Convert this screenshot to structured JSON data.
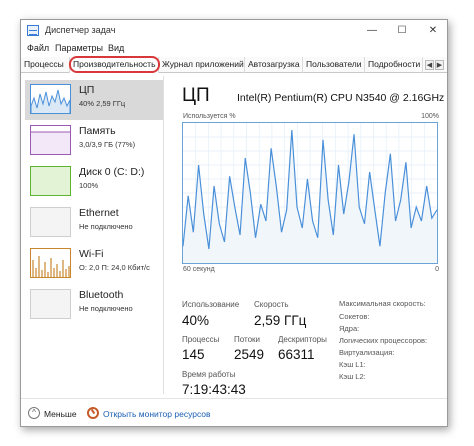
{
  "window": {
    "title": "Диспетчер задач",
    "controls": {
      "minimize": "—",
      "maximize": "☐",
      "close": "✕"
    }
  },
  "menu": [
    "Файл",
    "Параметры",
    "Вид"
  ],
  "tabs": [
    {
      "label": "Процессы",
      "active": false
    },
    {
      "label": "Производительность",
      "active": true
    },
    {
      "label": "Журнал приложений",
      "active": false
    },
    {
      "label": "Автозагрузка",
      "active": false
    },
    {
      "label": "Пользователи",
      "active": false
    },
    {
      "label": "Подробности",
      "active": false
    }
  ],
  "tab_scroll": {
    "left": "◀",
    "right": "▶"
  },
  "sidebar": [
    {
      "title": "ЦП",
      "sub": "40% 2,59 ГГц",
      "active": true,
      "color": "#4a90d9"
    },
    {
      "title": "Память",
      "sub": "3,0/3,9 ГБ (77%)",
      "active": false,
      "color": "#9b59b6"
    },
    {
      "title": "Диск 0 (C: D:)",
      "sub": "100%",
      "active": false,
      "color": "#5cb531"
    },
    {
      "title": "Ethernet",
      "sub": "Не подключено",
      "active": false,
      "color": "#aaaaaa"
    },
    {
      "title": "Wi-Fi",
      "sub": "О: 2,0 П: 24,0 Кбит/с",
      "active": false,
      "color": "#c8872f"
    },
    {
      "title": "Bluetooth",
      "sub": "Не подключено",
      "active": false,
      "color": "#aaaaaa"
    }
  ],
  "main": {
    "title": "ЦП",
    "subtitle": "Intel(R) Pentium(R) CPU N3540 @ 2.16GHz",
    "graph_label_left": "Используется %",
    "graph_label_right": "100%",
    "axis_left": "60 секунд",
    "axis_right": "0",
    "stats": {
      "utilization_label": "Использование",
      "utilization_value": "40%",
      "speed_label": "Скорость",
      "speed_value": "2,59 ГГц",
      "processes_label": "Процессы",
      "processes_value": "145",
      "threads_label": "Потоки",
      "threads_value": "2549",
      "handles_label": "Дескрипторы",
      "handles_value": "66311",
      "uptime_label": "Время работы",
      "uptime_value": "7:19:43:43"
    },
    "details": [
      "Максимальная скорость:",
      "Сокетов:",
      "Ядра:",
      "Логических процессоров:",
      "Виртуализация:",
      "Кэш L1:",
      "Кэш L2:"
    ]
  },
  "footer": {
    "fewer_label": "Меньше",
    "fewer_icon": "^",
    "monitor_link": "Открыть монитор ресурсов"
  },
  "colors": {
    "cpu_line": "#4a90d9",
    "cpu_fill": "#f1f6fb",
    "highlight": "#d9383b"
  },
  "cpu_history": [
    12,
    48,
    22,
    70,
    35,
    10,
    55,
    28,
    15,
    62,
    40,
    20,
    75,
    50,
    18,
    42,
    30,
    82,
    55,
    22,
    38,
    95,
    40,
    25,
    60,
    30,
    18,
    88,
    45,
    20,
    70,
    35,
    58,
    92,
    40,
    28,
    65,
    38,
    12,
    50,
    78,
    30,
    45,
    72,
    25,
    40,
    30,
    55,
    32,
    38
  ]
}
